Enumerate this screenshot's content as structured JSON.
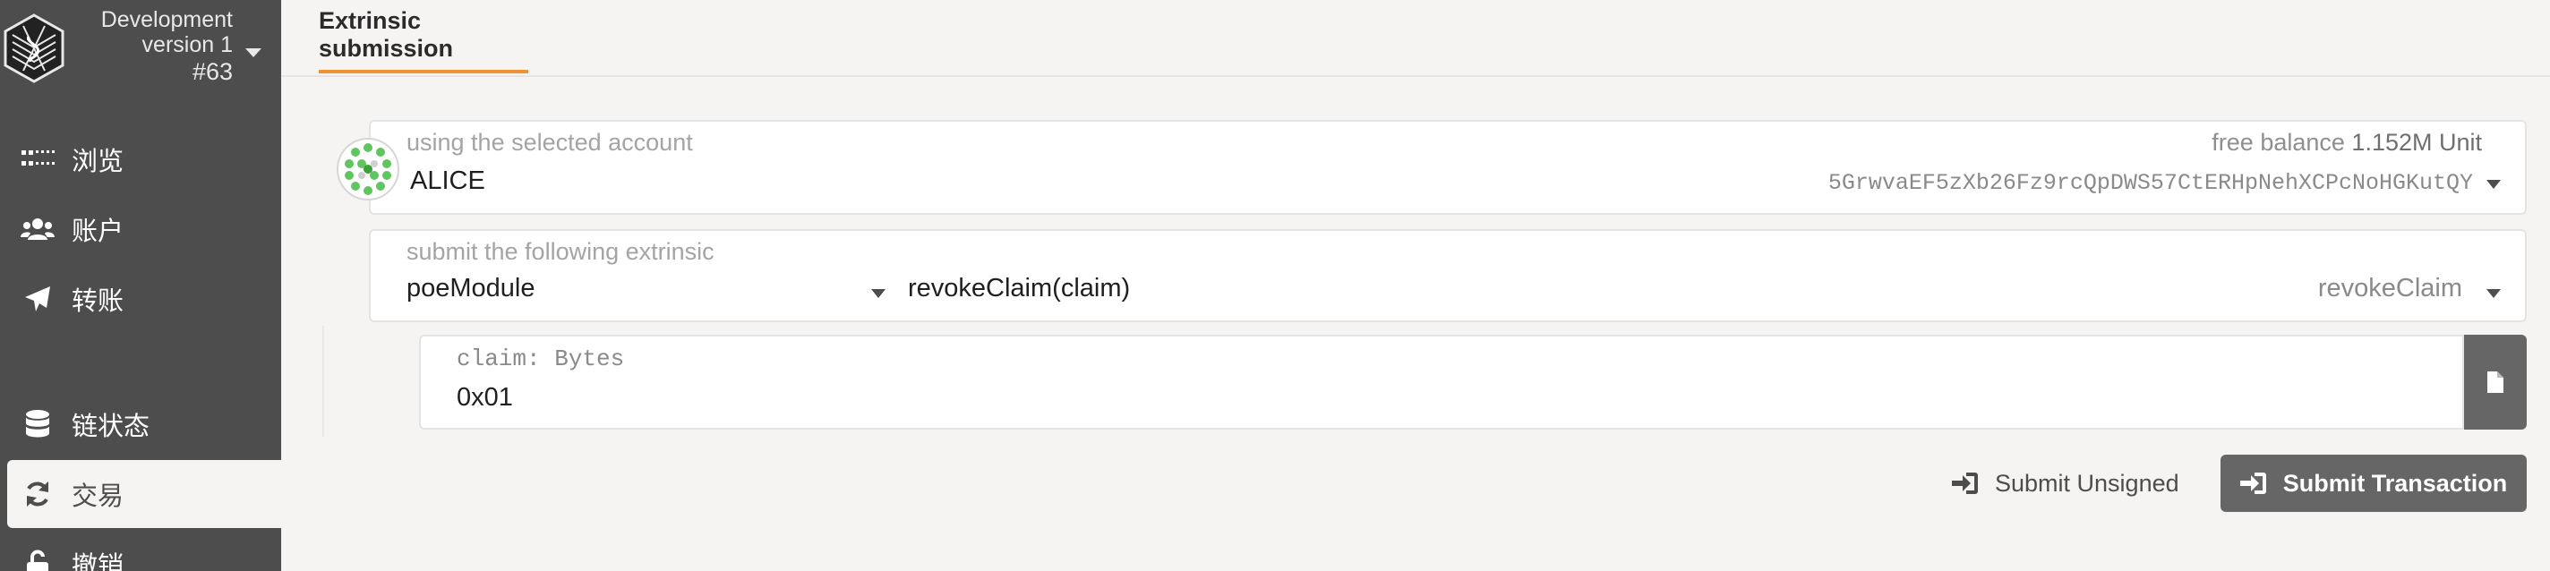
{
  "sidebar": {
    "chain": {
      "name": "Development",
      "version": "version 1",
      "block": "#63"
    },
    "items": [
      {
        "label": "浏览",
        "icon": "dots-grid-icon"
      },
      {
        "label": "账户",
        "icon": "users-icon"
      },
      {
        "label": "转账",
        "icon": "paper-plane-icon"
      },
      {
        "label": "链状态",
        "icon": "database-icon"
      },
      {
        "label": "交易",
        "icon": "sync-icon"
      },
      {
        "label": "撤销",
        "icon": "unlock-icon"
      }
    ]
  },
  "header": {
    "tab": "Extrinsic submission"
  },
  "account": {
    "label": "using the selected account",
    "name": "ALICE",
    "free_balance_label": "free balance",
    "free_balance_value": "1.152M Unit",
    "address": "5GrwvaEF5zXb26Fz9rcQpDWS57CtERHpNehXCPcNoHGKutQY"
  },
  "extrinsic": {
    "label": "submit the following extrinsic",
    "module": "poeModule",
    "call": "revokeClaim(claim)",
    "method": "revokeClaim"
  },
  "param": {
    "label": "claim: Bytes",
    "value": "0x01"
  },
  "actions": {
    "submit_unsigned": "Submit Unsigned",
    "submit_transaction": "Submit Transaction"
  },
  "colors": {
    "sidebar": "#4d4d4d",
    "accent": "#f19135",
    "button": "#666666",
    "background": "#f5f4f3"
  }
}
